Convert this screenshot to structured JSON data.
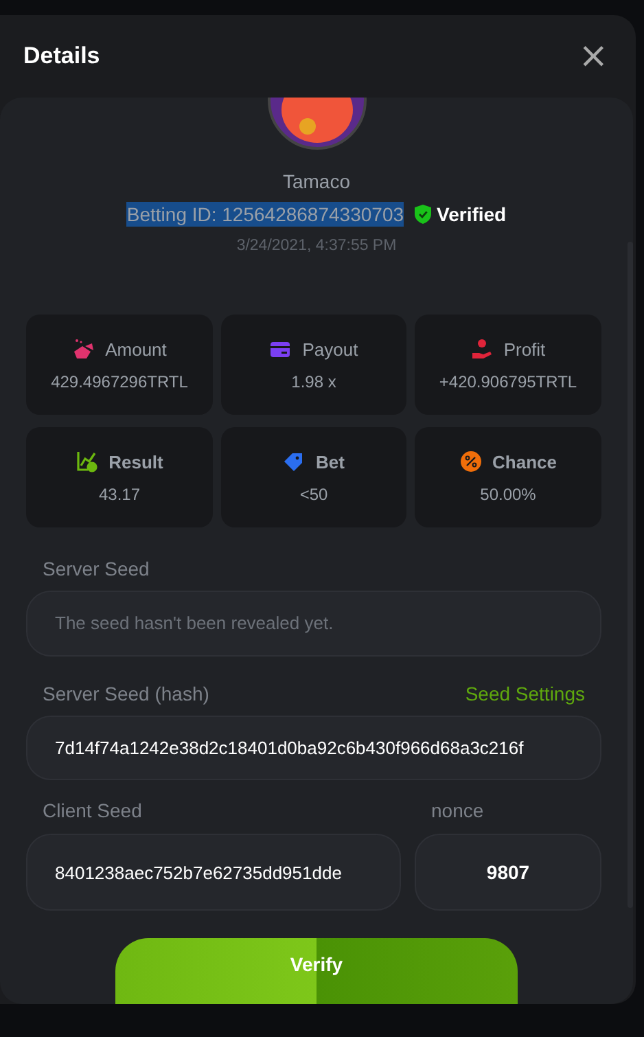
{
  "dialog": {
    "title": "Details",
    "close": "×"
  },
  "player": {
    "name": "Tamaco",
    "betting_id": "Betting ID: 12564286874330703",
    "id_selected": true,
    "verified": "Verified",
    "date": "3/24/2021, 4:37:55 PM"
  },
  "stats": [
    {
      "kind": "amount",
      "label": "Amount",
      "value": "429.4967296TRTL",
      "color": "#e0336e",
      "bold": false
    },
    {
      "kind": "payout",
      "label": "Payout",
      "value": "1.98 x",
      "color": "#7b3ff2",
      "bold": false
    },
    {
      "kind": "profit",
      "label": "Profit",
      "value": "+420.906795TRTL",
      "color": "#e0243a",
      "bold": false
    },
    {
      "kind": "result",
      "label": "Result",
      "value": "43.17",
      "color": "#6cb80f",
      "bold": true
    },
    {
      "kind": "bet",
      "label": "Bet",
      "value": "<50",
      "color": "#2b6ef0",
      "bold": true
    },
    {
      "kind": "chance",
      "label": "Chance",
      "value": "50.00%",
      "color": "#f06e0a",
      "bold": true
    }
  ],
  "server_seed": {
    "label": "Server Seed",
    "placeholder": "The seed hasn't been revealed yet."
  },
  "server_seed_hash": {
    "label": "Server Seed (hash)",
    "link": "Seed Settings",
    "value": "7d14f74a1242e38d2c18401d0ba92c6b430f966d68a3c216f"
  },
  "client_seed": {
    "label": "Client Seed",
    "value": "8401238aec752b7e62735dd951dde"
  },
  "nonce": {
    "label": "nonce",
    "value": "9807"
  },
  "verify_button": "Verify"
}
